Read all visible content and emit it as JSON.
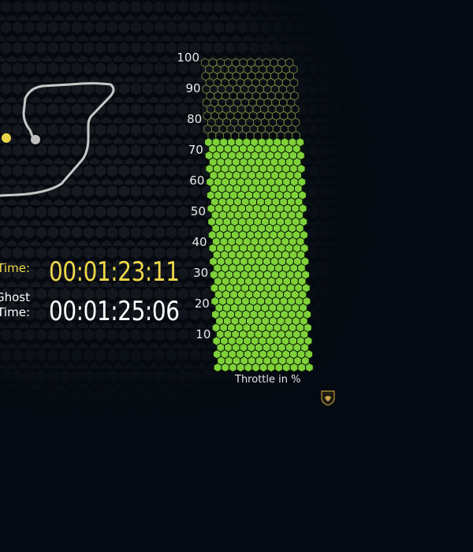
{
  "lap": {
    "time_label": "Time:",
    "time_value": "00:01:23:11",
    "ghost_label_line1": "Ghost",
    "ghost_label_line2": "Time:",
    "ghost_value": "00:01:25:06"
  },
  "throttle": {
    "label": "Throttle in %",
    "level_percent": 73,
    "ticks": [
      "10",
      "20",
      "30",
      "40",
      "50",
      "60",
      "70",
      "80",
      "90",
      "100"
    ]
  },
  "colors": {
    "accent_yellow": "#f0d94a",
    "throttle_green": "#7fd13a",
    "throttle_empty": "#6a7a3a",
    "track_line": "#c8c8c8",
    "background": "#050a12"
  },
  "icons": {
    "brand": "bull-shield-logo",
    "current_marker": "yellow-dot",
    "ghost_marker": "grey-dot"
  }
}
